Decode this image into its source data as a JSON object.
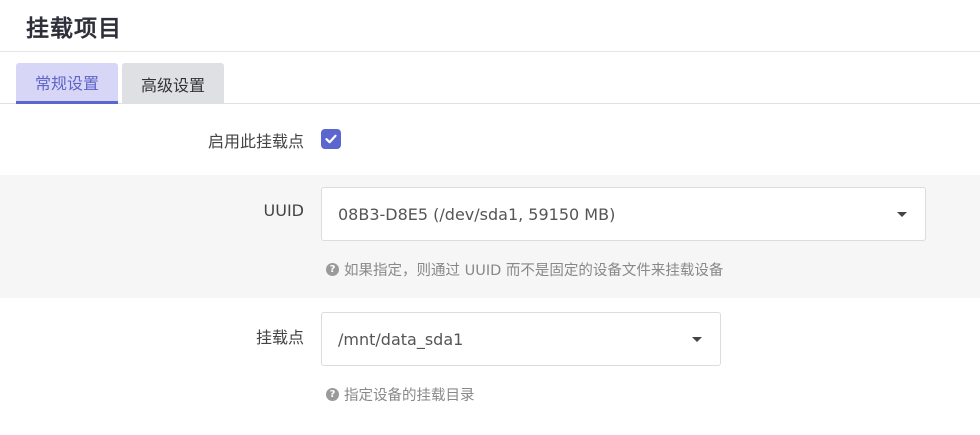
{
  "header": {
    "title": "挂载项目"
  },
  "tabs": [
    {
      "label": "常规设置",
      "active": true
    },
    {
      "label": "高级设置",
      "active": false
    }
  ],
  "form": {
    "enable": {
      "label": "启用此挂载点",
      "checked": true
    },
    "uuid": {
      "label": "UUID",
      "value": "08B3-D8E5 (/dev/sda1, 59150 MB)",
      "hint": "如果指定，则通过 UUID 而不是固定的设备文件来挂载设备"
    },
    "mountpoint": {
      "label": "挂载点",
      "value": "/mnt/data_sda1",
      "hint": "指定设备的挂载目录"
    }
  },
  "icons": {
    "hint": "question-circle-icon",
    "select": "caret-down-icon",
    "checkbox": "check-icon"
  },
  "colors": {
    "accent": "#5c66cf",
    "active_tab_bg": "#d8d6f7",
    "inactive_tab_bg": "#dfe0e4"
  }
}
